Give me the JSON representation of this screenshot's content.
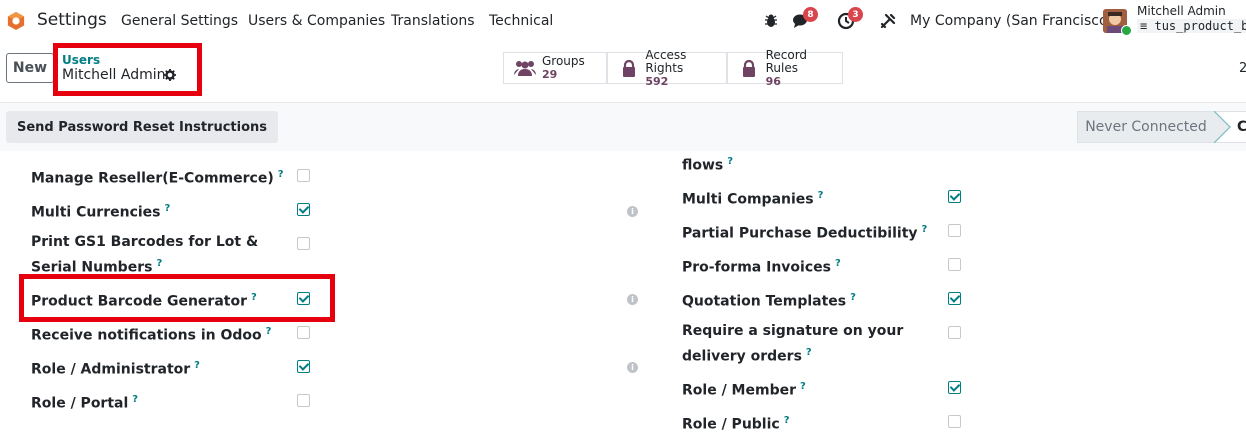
{
  "nav": {
    "app_title": "Settings",
    "menu": [
      "General Settings",
      "Users & Companies",
      "Translations",
      "Technical"
    ],
    "chat_badge": "8",
    "activity_badge": "3",
    "company": "My Company (San Francisco)",
    "user_name": "Mitchell Admin",
    "db_name": "tus_product_ba"
  },
  "control": {
    "new_label": "New",
    "breadcrumb_parent": "Users",
    "breadcrumb_current": "Mitchell Admin",
    "pager": "2"
  },
  "smart_buttons": [
    {
      "label": "Groups",
      "value": "29"
    },
    {
      "label": "Access Rights",
      "value": "592"
    },
    {
      "label": "Record Rules",
      "value": "96"
    }
  ],
  "statusbar": {
    "reset_button": "Send Password Reset Instructions",
    "state_never": "Never Connected",
    "state_next": "C"
  },
  "help_mark": "?",
  "info_mark": "i",
  "left_settings": [
    {
      "label": "Manage Reseller(E-Commerce)",
      "checked": false
    },
    {
      "label": "Multi Currencies",
      "checked": true
    },
    {
      "label": "Print GS1 Barcodes for Lot & Serial Numbers",
      "checked": false
    },
    {
      "label": "Product Barcode Generator",
      "checked": true
    },
    {
      "label": "Receive notifications in Odoo",
      "checked": false
    },
    {
      "label": "Role / Administrator",
      "checked": true
    },
    {
      "label": "Role / Portal",
      "checked": false
    }
  ],
  "right_settings": [
    {
      "label": "flows",
      "checked": null
    },
    {
      "label": "Multi Companies",
      "checked": true
    },
    {
      "label": "Partial Purchase Deductibility",
      "checked": false
    },
    {
      "label": "Pro-forma Invoices",
      "checked": false
    },
    {
      "label": "Quotation Templates",
      "checked": true
    },
    {
      "label": "Require a signature on your delivery orders",
      "checked": false
    },
    {
      "label": "Role / Member",
      "checked": true
    },
    {
      "label": "Role / Public",
      "checked": false
    }
  ],
  "colors": {
    "brand": "#714b67",
    "accent": "#017e84",
    "highlight": "#e6000d",
    "badge": "#d9454d"
  }
}
